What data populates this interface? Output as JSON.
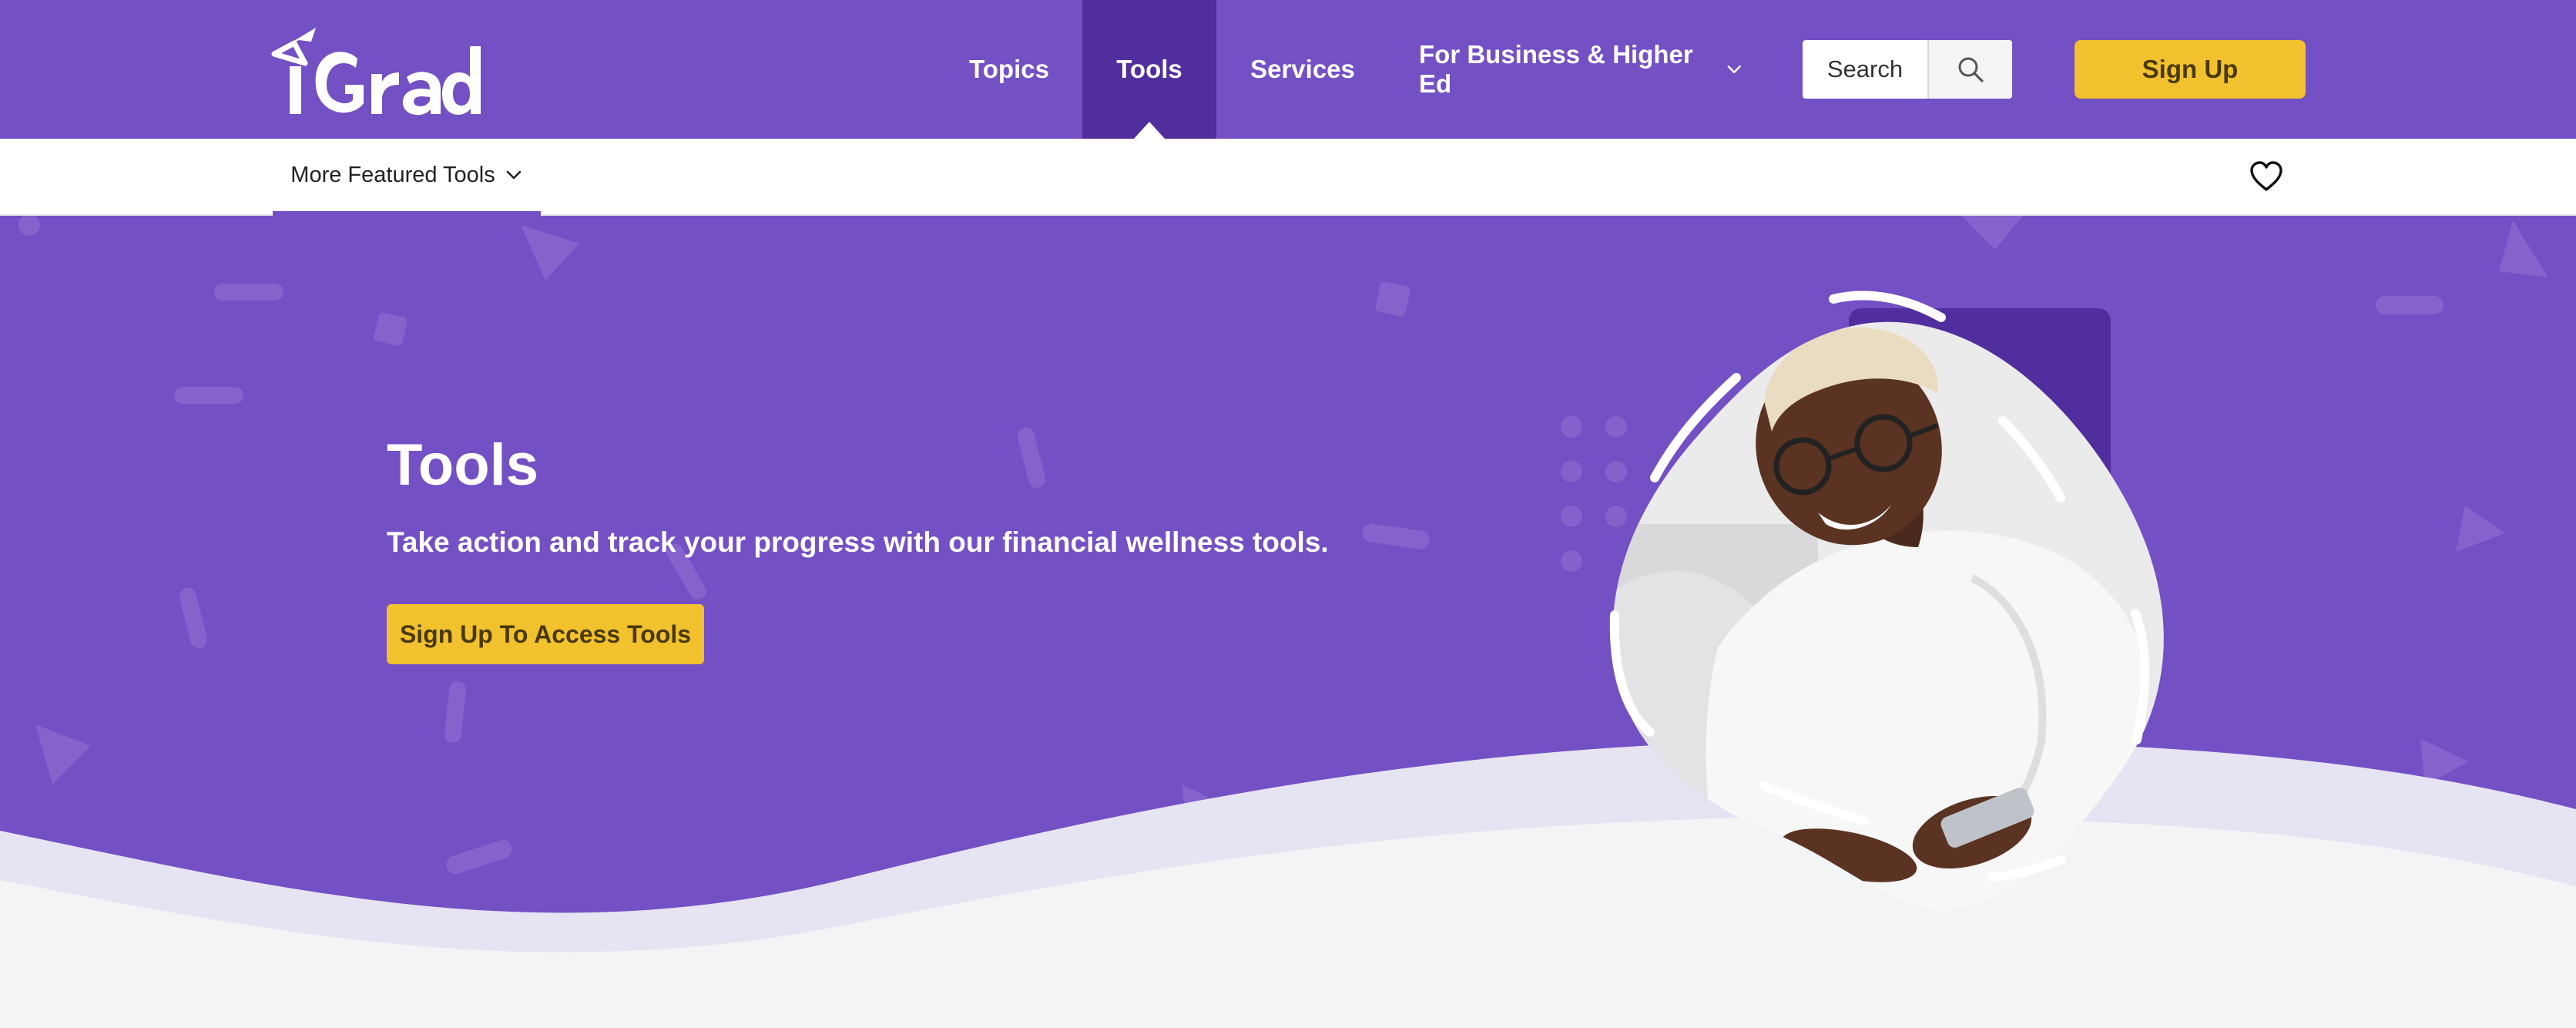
{
  "brand": {
    "logo_text": "iGrad"
  },
  "nav": {
    "items": [
      {
        "label": "Topics"
      },
      {
        "label": "Tools"
      },
      {
        "label": "Services"
      },
      {
        "label": "For Business & Higher Ed"
      }
    ],
    "active": "Tools",
    "search_label": "Search",
    "signup_label": "Sign Up"
  },
  "subnav": {
    "featured_label": "More Featured Tools"
  },
  "hero": {
    "title": "Tools",
    "subtitle": "Take action and track your progress with our financial wellness tools.",
    "cta_label": "Sign Up To Access Tools"
  },
  "colors": {
    "primary_purple": "#7350c4",
    "active_tab": "#512e9e",
    "accent_yellow": "#f2c12e",
    "light_bg": "#f3f4f6",
    "wave_lavender": "#e6e3f2"
  },
  "icons": {
    "search": "search-icon",
    "heart": "heart-icon",
    "chevron": "chevron-down-icon"
  }
}
